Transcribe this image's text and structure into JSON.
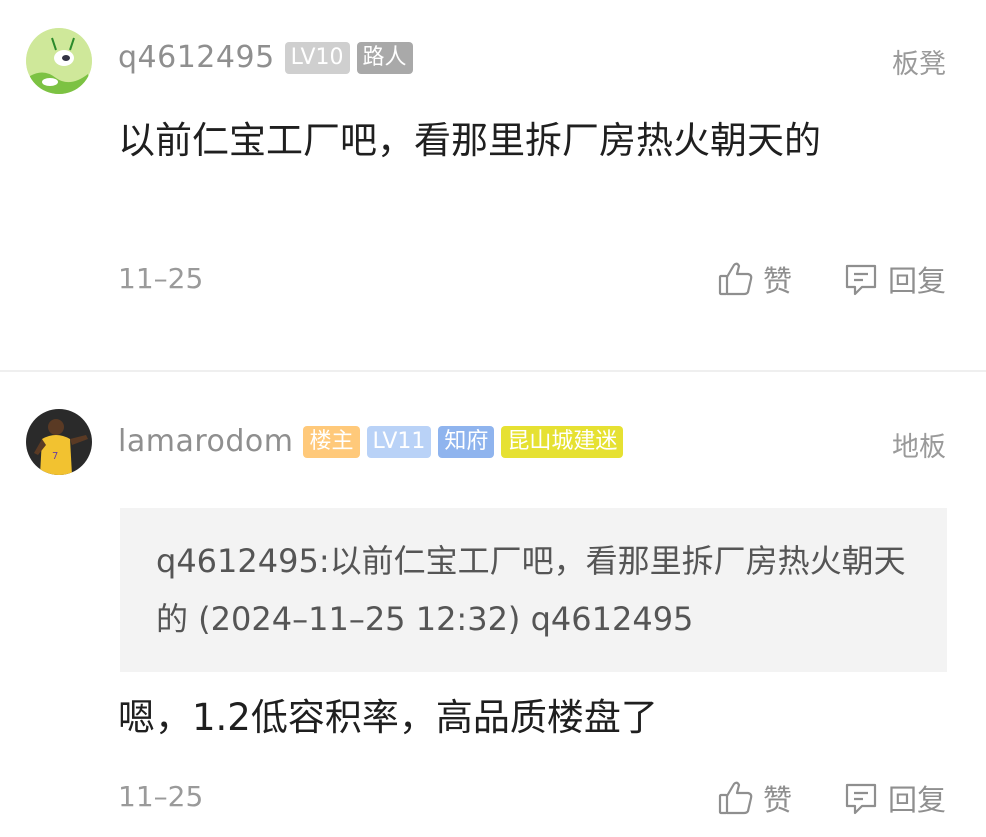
{
  "posts": [
    {
      "username": "q4612495",
      "badges": [
        {
          "text": "LV10",
          "color": "#cfcfcf"
        },
        {
          "text": "路人",
          "color": "#a9a9a9"
        }
      ],
      "floor": "板凳",
      "content": "以前仁宝工厂吧，看那里拆厂房热火朝天的",
      "date": "11–25",
      "like_label": "赞",
      "reply_label": "回复"
    },
    {
      "username": "lamarodom",
      "badges": [
        {
          "text": "楼主",
          "color": "#ffc97a"
        },
        {
          "text": "LV11",
          "color": "#b9d2f7"
        },
        {
          "text": "知府",
          "color": "#8fb4ee"
        },
        {
          "text": "昆山城建迷",
          "color": "#e6e132"
        }
      ],
      "floor": "地板",
      "quote": "q4612495:以前仁宝工厂吧，看那里拆厂房热火朝天的 (2024–11–25 12:32) q4612495",
      "content": "嗯，1.2低容积率，高品质楼盘了",
      "date": "11–25",
      "like_label": "赞",
      "reply_label": "回复"
    }
  ],
  "icons": {
    "like": "thumbs-up-icon",
    "reply": "comment-bubble-icon"
  }
}
